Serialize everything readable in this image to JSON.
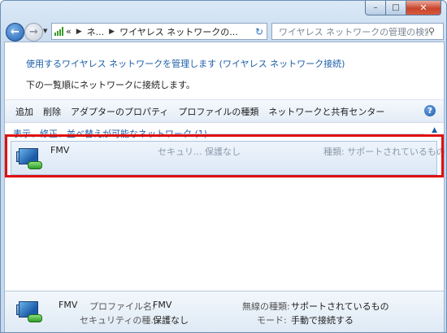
{
  "window": {
    "buttons": {
      "minimize": "–",
      "maximize": "□",
      "close": "✕"
    }
  },
  "nav": {
    "address_segments": [
      "«",
      "ネ...",
      "ワイヤレス ネットワークの..."
    ],
    "search_placeholder": "ワイヤレス ネットワークの管理の検索"
  },
  "main": {
    "heading": "使用するワイヤレス ネットワークを管理します (ワイヤレス ネットワーク接続)",
    "description": "下の一覧順にネットワークに接続します。"
  },
  "toolbar": {
    "items": [
      "追加",
      "削除",
      "アダプターのプロパティ",
      "プロファイルの種類",
      "ネットワークと共有センター"
    ],
    "help": "?"
  },
  "group": {
    "label": "表示、修正、並べ替えが可能なネットワーク (1)"
  },
  "network": {
    "name": "FMV",
    "security": "セキュリ... 保護なし",
    "type": "種類: サポートされているもの"
  },
  "details": {
    "name": "FMV",
    "profile_label": "プロファイル名:",
    "profile_value": "FMV",
    "security_label": "セキュリティの種...",
    "security_value": "保護なし",
    "radio_label": "無線の種類:",
    "radio_value": "サポートされているもの",
    "mode_label": "モード:",
    "mode_value": "手動で接続する"
  },
  "colors": {
    "highlight": "#e01010",
    "link": "#1d5fa8"
  }
}
